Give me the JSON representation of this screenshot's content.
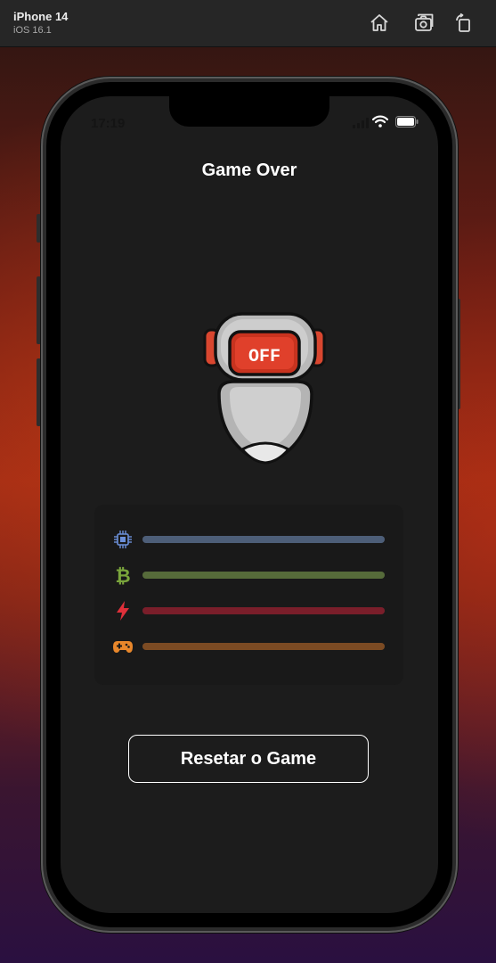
{
  "simulator": {
    "device_name": "iPhone 14",
    "os_version": "iOS 16.1",
    "toolbar_icons": [
      "home-icon",
      "screenshot-icon",
      "rotate-icon"
    ]
  },
  "status_bar": {
    "time": "17:19",
    "icons": [
      "signal-icon",
      "wifi-icon",
      "battery-icon"
    ]
  },
  "screen": {
    "title": "Game Over",
    "robot": {
      "display_text": "OFF",
      "icon": "robot-off-icon"
    },
    "stats": [
      {
        "name": "cpu",
        "icon": "cpu-chip-icon",
        "color": "#6b8fd8",
        "bar_color": "#4d5e78",
        "fill": 1.0
      },
      {
        "name": "bitcoin",
        "icon": "bitcoin-icon",
        "color": "#7aa53c",
        "bar_color": "#566b3a",
        "fill": 1.0
      },
      {
        "name": "energy",
        "icon": "lightning-icon",
        "color": "#e0303a",
        "bar_color": "#7a1e2a",
        "fill": 1.0
      },
      {
        "name": "gaming",
        "icon": "gamepad-icon",
        "color": "#e8872b",
        "bar_color": "#7c4b23",
        "fill": 1.0
      }
    ],
    "reset_button_label": "Resetar o Game"
  }
}
